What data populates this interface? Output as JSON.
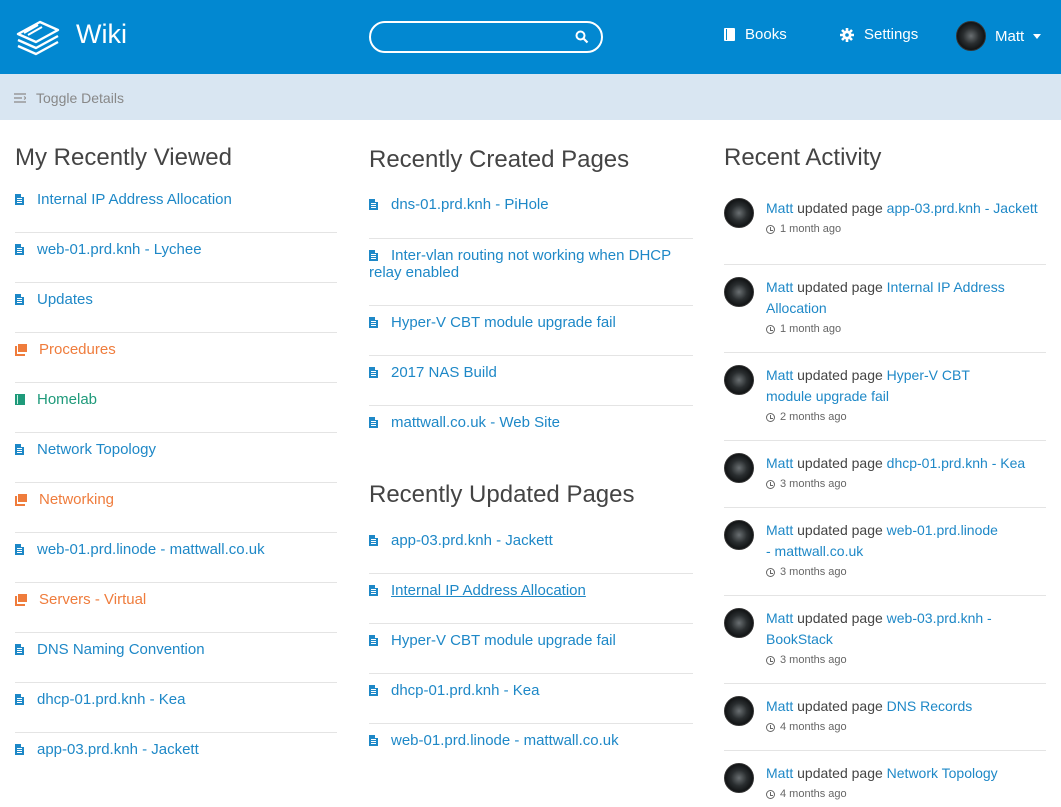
{
  "header": {
    "title": "Wiki",
    "search_placeholder": "",
    "nav": {
      "books": "Books",
      "settings": "Settings"
    },
    "user": "Matt",
    "brand_color": "#0288d1"
  },
  "toolbar": {
    "toggle_details": "Toggle Details"
  },
  "recently_viewed": {
    "title": "My Recently Viewed",
    "items": [
      {
        "label": "Internal IP Address Allocation",
        "type": "page"
      },
      {
        "label": "web-01.prd.knh - Lychee",
        "type": "page"
      },
      {
        "label": "Updates",
        "type": "page"
      },
      {
        "label": "Procedures",
        "type": "shelf"
      },
      {
        "label": "Homelab",
        "type": "book"
      },
      {
        "label": "Network Topology",
        "type": "page"
      },
      {
        "label": "Networking",
        "type": "shelf"
      },
      {
        "label": "web-01.prd.linode - mattwall.co.uk",
        "type": "page"
      },
      {
        "label": "Servers - Virtual",
        "type": "shelf"
      },
      {
        "label": "DNS Naming Convention",
        "type": "page"
      },
      {
        "label": "dhcp-01.prd.knh - Kea",
        "type": "page"
      },
      {
        "label": "app-03.prd.knh - Jackett",
        "type": "page"
      }
    ]
  },
  "recently_created": {
    "title": "Recently Created Pages",
    "items": [
      {
        "label": "dns-01.prd.knh - PiHole"
      },
      {
        "label": "Inter-vlan routing not working when DHCP relay enabled"
      },
      {
        "label": "Hyper-V CBT module upgrade fail"
      },
      {
        "label": "2017 NAS Build"
      },
      {
        "label": "mattwall.co.uk - Web Site"
      }
    ]
  },
  "recently_updated": {
    "title": "Recently Updated Pages",
    "items": [
      {
        "label": "app-03.prd.knh - Jackett"
      },
      {
        "label": "Internal IP Address Allocation"
      },
      {
        "label": "Hyper-V CBT module upgrade fail"
      },
      {
        "label": "dhcp-01.prd.knh - Kea"
      },
      {
        "label": "web-01.prd.linode - mattwall.co.uk"
      }
    ]
  },
  "recent_activity": {
    "title": "Recent Activity",
    "items": [
      {
        "user": "Matt",
        "action": "updated page",
        "target": "app-03.prd.knh - Jackett",
        "time": "1 month ago"
      },
      {
        "user": "Matt",
        "action": "updated page",
        "target": "Internal IP Address Allocation",
        "time": "1 month ago"
      },
      {
        "user": "Matt",
        "action": "updated page",
        "target": "Hyper-V CBT module upgrade fail",
        "time": "2 months ago"
      },
      {
        "user": "Matt",
        "action": "updated page",
        "target": "dhcp-01.prd.knh - Kea",
        "time": "3 months ago"
      },
      {
        "user": "Matt",
        "action": "updated page",
        "target": "web-01.prd.linode - mattwall.co.uk",
        "time": "3 months ago"
      },
      {
        "user": "Matt",
        "action": "updated page",
        "target": "web-03.prd.knh - BookStack",
        "time": "3 months ago"
      },
      {
        "user": "Matt",
        "action": "updated page",
        "target": "DNS Records",
        "time": "4 months ago"
      },
      {
        "user": "Matt",
        "action": "updated page",
        "target": "Network Topology",
        "time": "4 months ago"
      }
    ]
  }
}
